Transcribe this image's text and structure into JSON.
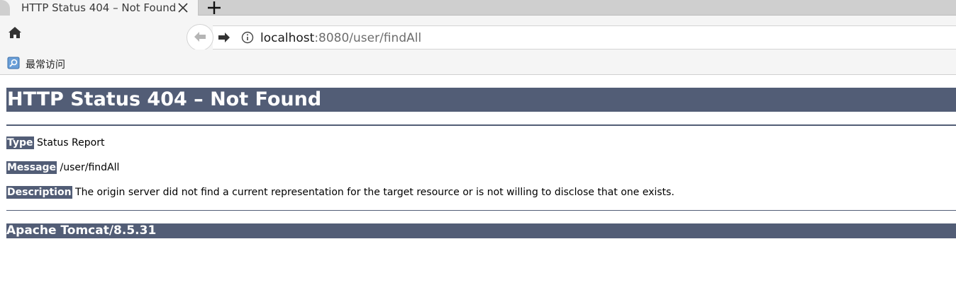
{
  "tab": {
    "title": "HTTP Status 404 – Not Found"
  },
  "navbar": {
    "url_host": "localhost",
    "url_rest": ":8080/user/findAll"
  },
  "bookmarks": {
    "label": "最常访问"
  },
  "page": {
    "heading": "HTTP Status 404 – Not Found",
    "type_label": "Type",
    "type_value": "Status Report",
    "message_label": "Message",
    "message_value": "/user/findAll",
    "description_label": "Description",
    "description_value": "The origin server did not find a current representation for the target resource or is not willing to disclose that one exists.",
    "footer": "Apache Tomcat/8.5.31"
  },
  "colors": {
    "tomcat_header_bg": "#525d76",
    "tab_bg": "#f5f5f5",
    "chrome_bg": "#cfcfcf"
  },
  "icons": {
    "close": "close-icon",
    "new_tab": "plus-icon",
    "home": "home-icon",
    "back": "arrow-left-icon",
    "forward": "arrow-right-icon",
    "info": "info-icon",
    "bookmark": "bookmark-folder-icon"
  }
}
